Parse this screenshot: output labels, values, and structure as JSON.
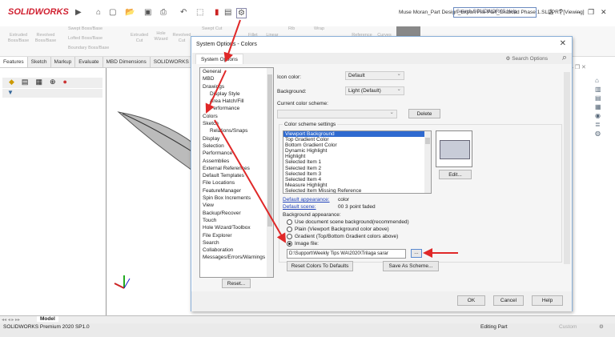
{
  "app": {
    "brand": "SOLIDWORKS",
    "title": "Muse Moran_Part Design_Export File Part_Grabcad Phase 1.SLDPRT [Viewing]",
    "help_search_placeholder": "Search SOLIDWORKS Help"
  },
  "ribbon": {
    "items": [
      "Extruded Boss/Base",
      "Revolved Boss/Base",
      "Swept Boss/Base",
      "Lofted Boss/Base",
      "Boundary Boss/Base",
      "Extruded Cut",
      "Hole Wizard",
      "Revolved Cut",
      "Swept Cut",
      "Fillet",
      "Linear Pattern",
      "Rib",
      "Wrap",
      "Reference Geometry",
      "Curves"
    ]
  },
  "tabs": [
    "Features",
    "Sketch",
    "Markup",
    "Evaluate",
    "MBD Dimensions",
    "SOLIDWORKS"
  ],
  "dialog": {
    "title": "System Options - Colors",
    "tab": "System Options",
    "search_placeholder": "Search Options",
    "nav": [
      {
        "label": "General"
      },
      {
        "label": "MBD"
      },
      {
        "label": "Drawings"
      },
      {
        "label": "Display Style",
        "sub": true
      },
      {
        "label": "Area Hatch/Fill",
        "sub": true
      },
      {
        "label": "Performance",
        "sub": true
      },
      {
        "label": "Colors"
      },
      {
        "label": "Sketch"
      },
      {
        "label": "Relations/Snaps",
        "sub": true
      },
      {
        "label": "Display"
      },
      {
        "label": "Selection"
      },
      {
        "label": "Performance"
      },
      {
        "label": "Assemblies"
      },
      {
        "label": "External References"
      },
      {
        "label": "Default Templates"
      },
      {
        "label": "File Locations"
      },
      {
        "label": "FeatureManager"
      },
      {
        "label": "Spin Box Increments"
      },
      {
        "label": "View"
      },
      {
        "label": "Backup/Recover"
      },
      {
        "label": "Touch"
      },
      {
        "label": "Hole Wizard/Toolbox"
      },
      {
        "label": "File Explorer"
      },
      {
        "label": "Search"
      },
      {
        "label": "Collaboration"
      },
      {
        "label": "Messages/Errors/Warnings"
      }
    ],
    "reset": "Reset...",
    "icon_color_label": "Icon color:",
    "icon_color_value": "Default",
    "background_label": "Background:",
    "background_value": "Light (Default)",
    "scheme_label": "Current color scheme:",
    "scheme_value": "",
    "delete": "Delete",
    "group_label": "Color scheme settings",
    "scheme_items": [
      "Viewport Background",
      "Top Gradient Color",
      "Bottom Gradient Color",
      "Dynamic Highlight",
      "Highlight",
      "Selected Item 1",
      "Selected Item 2",
      "Selected Item 3",
      "Selected Item 4",
      "Measure Highlight",
      "Selected Item Missing Reference"
    ],
    "preview_color": "#c8ccd8",
    "edit": "Edit...",
    "default_appearance_label": "Default appearance:",
    "default_appearance_value": "color",
    "default_scene_label": "Default scene:",
    "default_scene_value": "00 3 point faded",
    "bg_appearance_label": "Background appearance:",
    "radios": [
      "Use document scene background(recommended)",
      "Plain (Viewport Background color above)",
      "Gradient (Top/Bottom Gradient colors above)",
      "Image file:"
    ],
    "selected_radio": 3,
    "image_path": "D:\\Support\\Weekly Tips WA\\2020\\Trilaga sarar",
    "browse": "...",
    "reset_colors": "Reset Colors To Defaults",
    "save_scheme": "Save As Scheme...",
    "ok": "OK",
    "cancel": "Cancel",
    "help": "Help"
  },
  "bottom_tab": "Model",
  "status": {
    "left": "SOLIDWORKS Premium 2020 SP1.0",
    "mid": "Editing Part",
    "right": "Custom"
  }
}
